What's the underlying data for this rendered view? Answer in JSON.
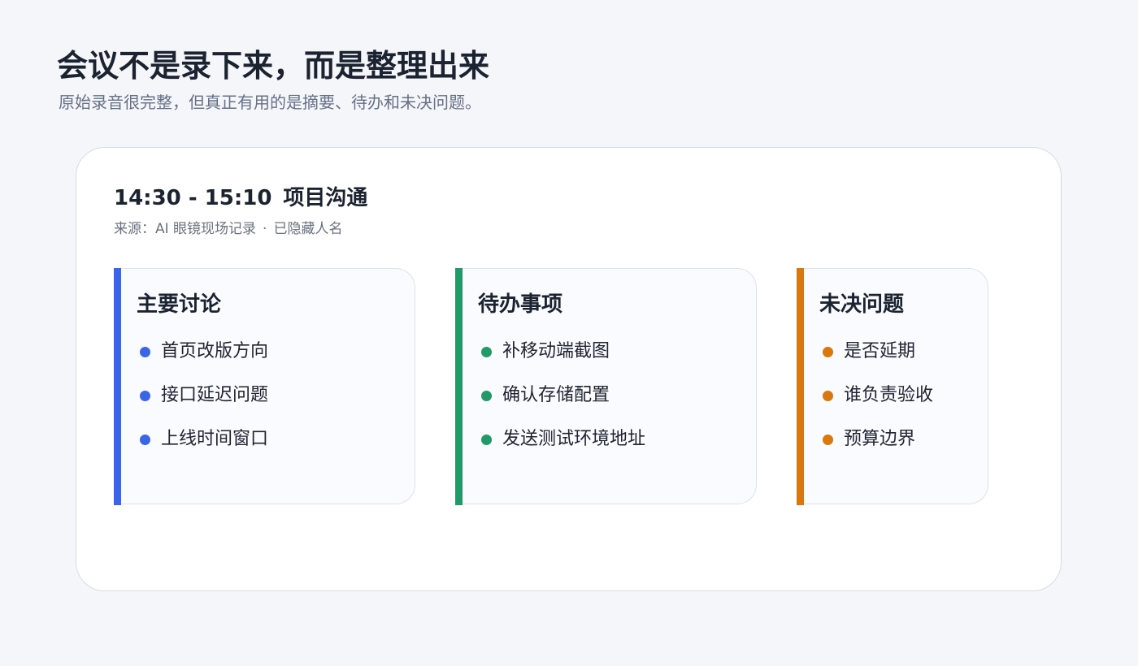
{
  "header": {
    "title": "会议不是录下来，而是整理出来",
    "subtitle": "原始录音很完整，但真正有用的是摘要、待办和未决问题。"
  },
  "meeting": {
    "time": "14:30 - 15:10",
    "name": "项目沟通",
    "source": "来源：AI 眼镜现场记录",
    "separator": "·",
    "privacy": "已隐藏人名"
  },
  "panels": [
    {
      "heading": "主要讨论",
      "accent_color": "#3a66e6",
      "items": [
        "首页改版方向",
        "接口延迟问题",
        "上线时间窗口"
      ]
    },
    {
      "heading": "待办事项",
      "accent_color": "#23996a",
      "items": [
        "补移动端截图",
        "确认存储配置",
        "发送测试环境地址"
      ]
    },
    {
      "heading": "未决问题",
      "accent_color": "#d9780f",
      "items": [
        "是否延期",
        "谁负责验收",
        "预算边界"
      ]
    }
  ]
}
